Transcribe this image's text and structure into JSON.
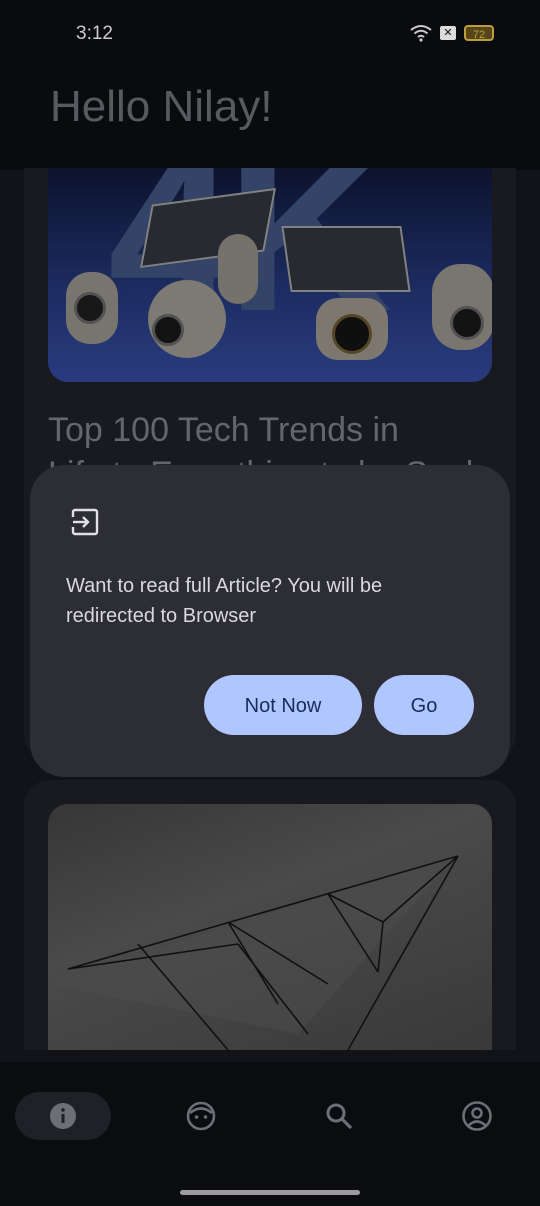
{
  "status_bar": {
    "time": "3:12",
    "battery": "72",
    "icons": [
      "wifi-icon",
      "x-box-icon",
      "battery-icon"
    ]
  },
  "header": {
    "greeting": "Hello Nilay!"
  },
  "articles": [
    {
      "title": "Top 100 Tech Trends in",
      "title_line2_partial": "Life to Everything to be Seek",
      "image": "security-cameras-with-solar-panels"
    },
    {
      "title": "",
      "image": "abstract-geometric-lines"
    }
  ],
  "dialog": {
    "icon": "exit-to-app-icon",
    "message": "Want to read full Article? You will be redirected to Browser",
    "buttons": {
      "not_now": "Not Now",
      "go": "Go"
    }
  },
  "bottom_nav": {
    "items": [
      {
        "icon": "info-icon",
        "active": true
      },
      {
        "icon": "face-icon",
        "active": false
      },
      {
        "icon": "search-icon",
        "active": false
      },
      {
        "icon": "account-icon",
        "active": false
      }
    ]
  },
  "colors": {
    "accent": "#b0c6ff",
    "dialog_bg": "#2c2d35",
    "background": "#14151a"
  }
}
